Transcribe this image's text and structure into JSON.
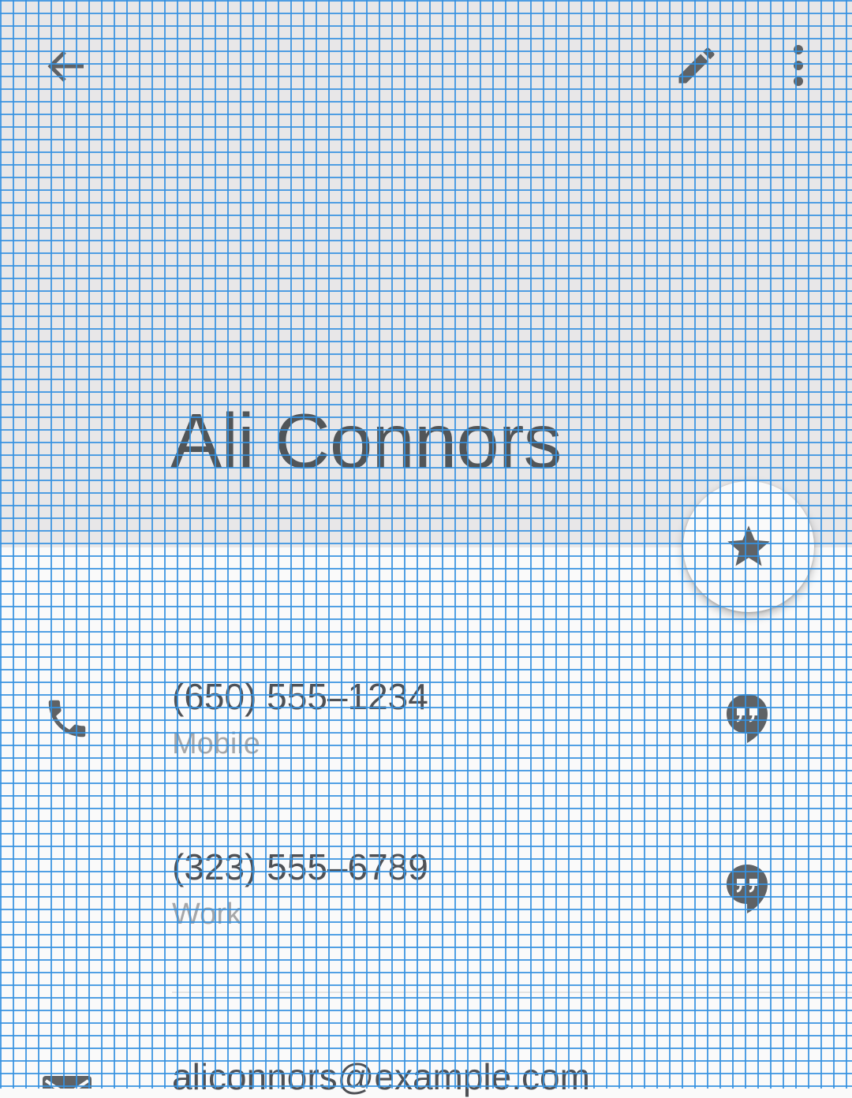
{
  "header": {
    "contact_name": "Ali Connors",
    "background_color": "#e8e7e8",
    "icons": [
      "back-arrow-icon",
      "edit-pencil-icon",
      "more-vert-icon"
    ]
  },
  "favorite": {
    "icon": "star-icon"
  },
  "phones": [
    {
      "number": "(650) 555–1234",
      "type": "Mobile",
      "icon": "phone-icon",
      "action_icon": "hangouts-icon"
    },
    {
      "number": "(323) 555–6789",
      "type": "Work",
      "action_icon": "hangouts-icon"
    }
  ],
  "emails": [
    {
      "address": "aliconnors@example.com",
      "icon": "email-icon"
    }
  ],
  "colors": {
    "text_primary": "#4e5156",
    "text_secondary": "#a6a7a9",
    "icon": "#5f6265",
    "grid_overlay": "#3491e1"
  }
}
